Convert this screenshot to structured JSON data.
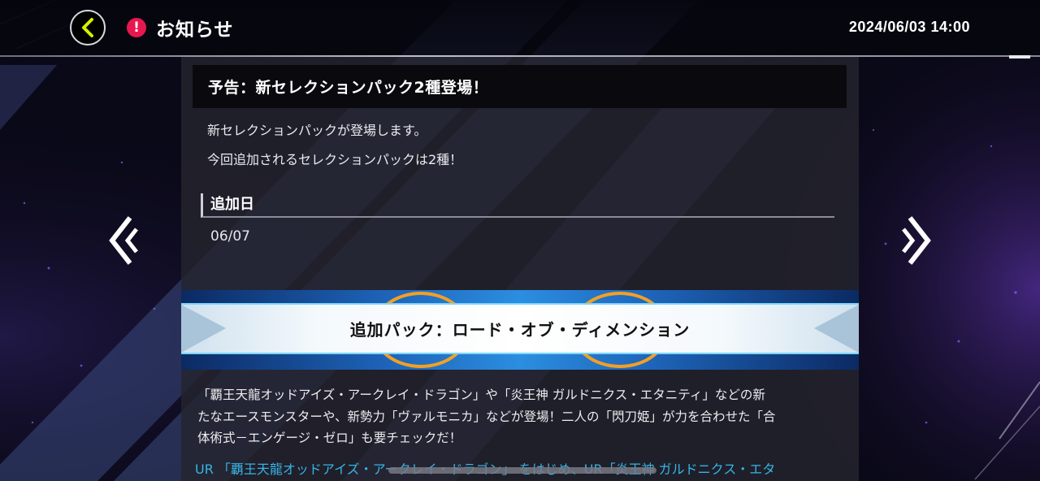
{
  "header": {
    "back_icon": "chevron-left-icon",
    "alert_icon_glyph": "!",
    "title": "お知らせ",
    "datetime": "2024/06/03 14:00"
  },
  "colors": {
    "accent_yellow": "#d4f000",
    "alert_red": "#e6184f",
    "link_blue": "#36b5e6",
    "banner_blue": "#1e63b8"
  },
  "notice": {
    "title": "予告：新セレクションパック2種登場！",
    "intro_lines": [
      "新セレクションパックが登場します。",
      "今回追加されるセレクションパックは2種！"
    ],
    "section_heading": "追加日",
    "date": "06/07",
    "banner_title": "追加パック：ロード・オブ・ディメンション",
    "description_lines": [
      "「覇王天龍オッドアイズ・アークレイ・ドラゴン」や「炎王神 ガルドニクス・エタニティ」などの新",
      "たなエースモンスターや、新勢力「ヴァルモニカ」などが登場！二人の「閃刀姫」が力を合わせた「合",
      "体術式－エンゲージ・ゼロ」も要チェックだ！"
    ],
    "link_line": "UR 「覇王天龍オッドアイズ・アークレイ・ドラゴン」 をはじめ、UR「炎王神 ガルドニクス・エタ"
  },
  "navigation": {
    "prev_icon": "double-chevron-left-icon",
    "next_icon": "double-chevron-right-icon"
  }
}
